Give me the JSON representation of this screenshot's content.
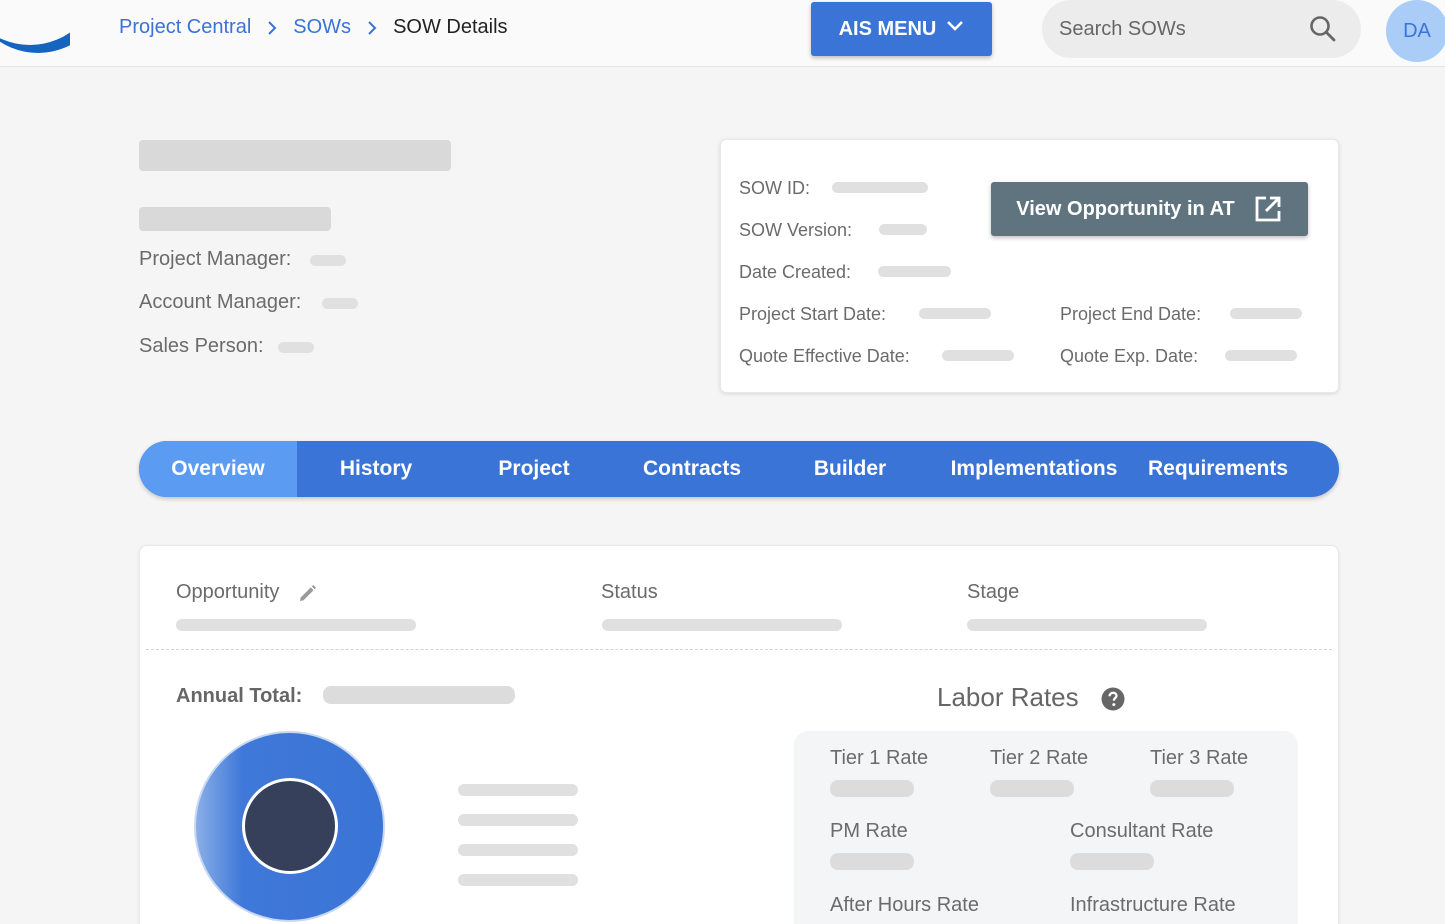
{
  "breadcrumb": {
    "items": [
      "Project Central",
      "SOWs"
    ],
    "current": "SOW Details"
  },
  "header": {
    "ais_menu_label": "AIS MENU",
    "search_placeholder": "Search SOWs",
    "avatar_initials": "DA"
  },
  "project": {
    "project_manager_label": "Project Manager:",
    "account_manager_label": "Account Manager:",
    "sales_person_label": "Sales Person:"
  },
  "info_card": {
    "sow_id_label": "SOW ID:",
    "sow_version_label": "SOW Version:",
    "date_created_label": "Date Created:",
    "project_start_label": "Project Start Date:",
    "project_end_label": "Project End Date:",
    "quote_effective_label": "Quote Effective Date:",
    "quote_exp_label": "Quote Exp. Date:",
    "view_button_label": "View Opportunity in AT"
  },
  "tabs": [
    "Overview",
    "History",
    "Project",
    "Contracts",
    "Builder",
    "Implementations",
    "Requirements"
  ],
  "active_tab": "Overview",
  "overview": {
    "opportunity_label": "Opportunity",
    "status_label": "Status",
    "stage_label": "Stage",
    "annual_total_label": "Annual Total:"
  },
  "labor_rates": {
    "title": "Labor Rates",
    "tier1": "Tier 1 Rate",
    "tier2": "Tier 2 Rate",
    "tier3": "Tier 3 Rate",
    "pm": "PM Rate",
    "consultant": "Consultant Rate",
    "after_hours": "After Hours Rate",
    "infrastructure": "Infrastructure Rate"
  },
  "colors": {
    "primary": "#3a74d6",
    "active_tab": "#5b9bf2",
    "view_button": "#607480",
    "avatar_bg": "#a9cdf6",
    "donut_center": "#36405a"
  },
  "icons": [
    "chevron-right-icon",
    "chevron-down-icon",
    "search-icon",
    "external-link-icon",
    "pencil-icon",
    "help-icon"
  ]
}
